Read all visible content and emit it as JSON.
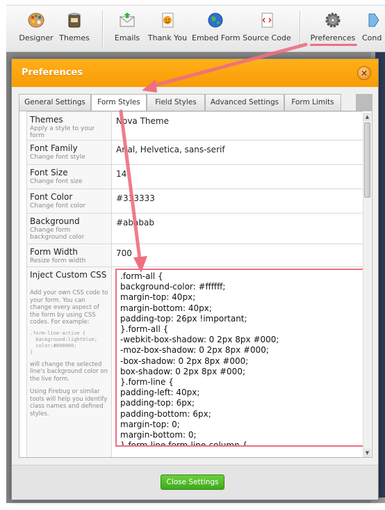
{
  "toolbar": {
    "items": [
      {
        "label": "Designer",
        "icon": "palette-icon"
      },
      {
        "label": "Themes",
        "icon": "paint-bucket-icon"
      },
      {
        "label": "Emails",
        "icon": "email-icon"
      },
      {
        "label": "Thank You",
        "icon": "thank-you-icon"
      },
      {
        "label": "Embed Form",
        "icon": "globe-icon"
      },
      {
        "label": "Source Code",
        "icon": "source-code-icon"
      },
      {
        "label": "Preferences",
        "icon": "gear-icon"
      },
      {
        "label": "Cond",
        "icon": "conditions-icon"
      }
    ]
  },
  "modal": {
    "title": "Preferences",
    "close_symbol": "×",
    "close_label": "Close Settings"
  },
  "tabs": [
    {
      "label": "General Settings",
      "active": false
    },
    {
      "label": "Form Styles",
      "active": true
    },
    {
      "label": "Field Styles",
      "active": false
    },
    {
      "label": "Advanced Settings",
      "active": false
    },
    {
      "label": "Form Limits",
      "active": false
    }
  ],
  "settings": [
    {
      "label": "Themes",
      "desc": "Apply a style to your form",
      "value": "Nova Theme"
    },
    {
      "label": "Font Family",
      "desc": "Change font style",
      "value": "Arial, Helvetica, sans-serif"
    },
    {
      "label": "Font Size",
      "desc": "Change font size",
      "value": "14"
    },
    {
      "label": "Font Color",
      "desc": "Change font color",
      "value": "#333333"
    },
    {
      "label": "Background",
      "desc": "Change form background color",
      "value": "#ababab"
    },
    {
      "label": "Form Width",
      "desc": "Resize form width",
      "value": "700"
    }
  ],
  "custom_css": {
    "label": "Inject Custom CSS",
    "help1": "Add your own CSS code to your form. You can change every aspect of the form by using CSS codes. For example:",
    "example": ".form-line-active {\n  background:lightblue;\n  color:#000000;\n}",
    "help2": "will change the selected line's background color on the live form.",
    "help3": "Using Firebug or similar tools will help you identify class names and defined styles.",
    "code_lines": [
      ".form-all {",
      "background-color: #ffffff;",
      "margin-top: 40px;",
      "margin-bottom: 40px;",
      "padding-top: 26px !important;",
      "}.form-all {",
      "-webkit-box-shadow: 0 2px 8px #000;",
      "-moz-box-shadow: 0 2px 8px #000;",
      "-box-shadow: 0 2px 8px #000;",
      "box-shadow: 0 2px 8px #000;",
      "}.form-line {",
      "padding-left: 40px;",
      "padding-top: 6px;",
      "padding-bottom: 6px;",
      "margin-top: 0;",
      "margin-bottom: 0;",
      "}.form-line.form-line-column {"
    ]
  },
  "colors": {
    "header_orange": "#f89c05",
    "annotation_pink": "#ee6f80",
    "button_green": "#3ea91d"
  }
}
